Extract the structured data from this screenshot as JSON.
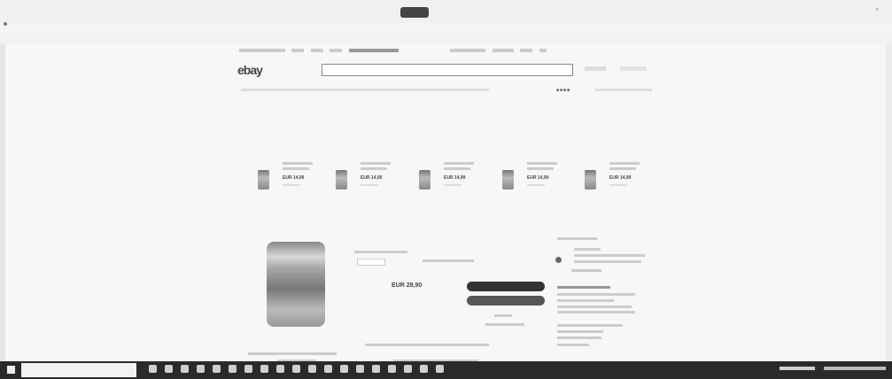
{
  "browser": {
    "tab_title": "",
    "tab_subtitle": "",
    "address_url": ""
  },
  "header": {
    "logo": "ebay",
    "search_placeholder": "",
    "share_icons": "■■■■"
  },
  "recommendations": {
    "title": "",
    "items": [
      {
        "name": "",
        "price": "EUR 14,99"
      },
      {
        "name": "",
        "price": "EUR 14,99"
      },
      {
        "name": "",
        "price": "EUR 14,99"
      },
      {
        "name": "",
        "price": "EUR 14,99"
      },
      {
        "name": "",
        "price": "EUR 14,99"
      }
    ]
  },
  "product": {
    "title": "",
    "price_label": "",
    "price": "EUR 28,90",
    "buy_now_label": "",
    "add_to_cart_label": ""
  },
  "seller": {
    "heading": ""
  },
  "taskbar": {
    "search_text": ""
  }
}
